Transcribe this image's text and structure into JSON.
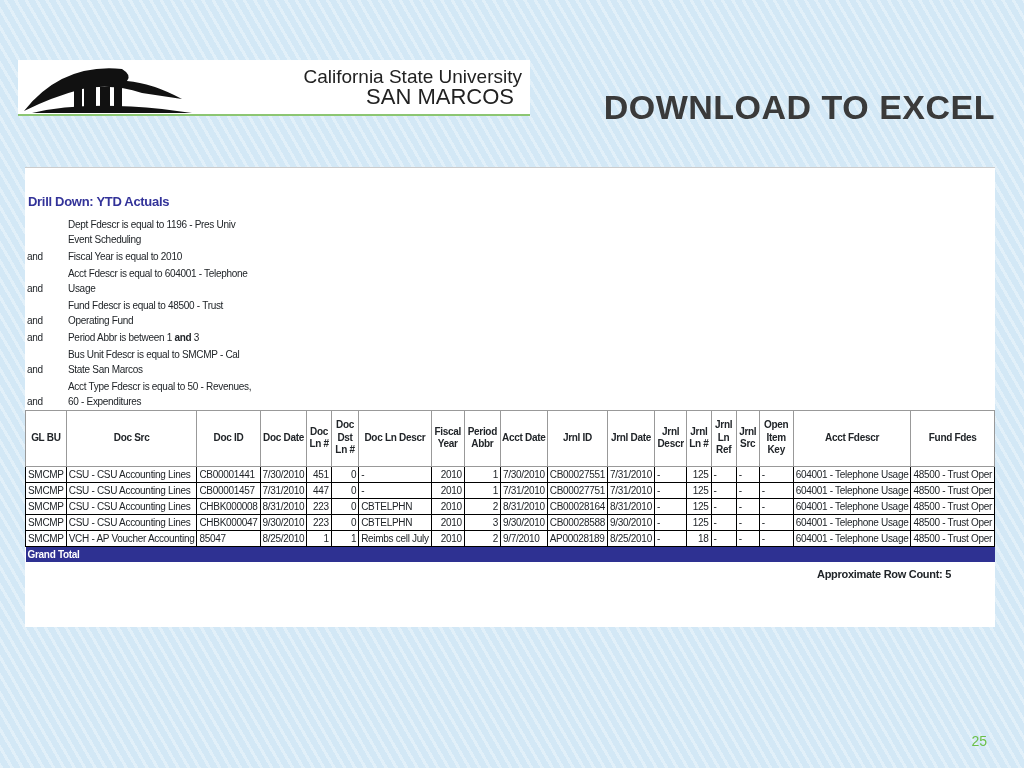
{
  "logo": {
    "line1": "California State University",
    "line2": "SAN MARCOS"
  },
  "title": "DOWNLOAD TO EXCEL",
  "report": {
    "title": "Drill Down: YTD Actuals",
    "filters": [
      {
        "text": "Dept Fdescr is equal to 1196 - Pres Univ Event Scheduling"
      },
      {
        "conjunction": "and",
        "text": "Fiscal Year is equal to 2010"
      },
      {
        "conjunction": "and",
        "text": "Acct Fdescr is equal to 604001 - Telephone Usage"
      },
      {
        "conjunction": "and",
        "text": "Fund Fdescr is equal to 48500 - Trust Operating Fund"
      },
      {
        "conjunction": "and",
        "text": "Period Abbr is between 1 **and** 3"
      },
      {
        "conjunction": "and",
        "text": "Bus Unit Fdescr is equal to SMCMP - Cal State San Marcos"
      },
      {
        "conjunction": "and",
        "text": "Acct Type Fdescr is equal to 50 - Revenues, 60 - Expenditures"
      }
    ],
    "columns": [
      {
        "label": "GL BU",
        "kind": "text"
      },
      {
        "label": "Doc Src",
        "kind": "text"
      },
      {
        "label": "Doc ID",
        "kind": "text"
      },
      {
        "label": "Doc Date",
        "kind": "text"
      },
      {
        "label": "Doc Ln #",
        "kind": "number"
      },
      {
        "label": "Doc Dst Ln #",
        "kind": "number"
      },
      {
        "label": "Doc Ln Descr",
        "kind": "text"
      },
      {
        "label": "Fiscal Year",
        "kind": "number"
      },
      {
        "label": "Period Abbr",
        "kind": "number"
      },
      {
        "label": "Acct Date",
        "kind": "text"
      },
      {
        "label": "Jrnl ID",
        "kind": "text"
      },
      {
        "label": "Jrnl Date",
        "kind": "text"
      },
      {
        "label": "Jrnl Descr",
        "kind": "text"
      },
      {
        "label": "Jrnl Ln #",
        "kind": "number"
      },
      {
        "label": "Jrnl Ln Ref",
        "kind": "text"
      },
      {
        "label": "Jrnl Src",
        "kind": "text"
      },
      {
        "label": "Open Item Key",
        "kind": "text"
      },
      {
        "label": "Acct Fdescr",
        "kind": "text"
      },
      {
        "label": "Fund Fdes",
        "kind": "text"
      }
    ],
    "rows": [
      [
        "SMCMP",
        "CSU - CSU Accounting Lines",
        "CB00001441",
        "7/30/2010",
        "451",
        "0",
        "-",
        "2010",
        "1",
        "7/30/2010",
        "CB00027551",
        "7/31/2010",
        "-",
        "125",
        "-",
        "-",
        "-",
        "604001 - Telephone Usage",
        "48500 - Trust Oper"
      ],
      [
        "SMCMP",
        "CSU - CSU Accounting Lines",
        "CB00001457",
        "7/31/2010",
        "447",
        "0",
        "-",
        "2010",
        "1",
        "7/31/2010",
        "CB00027751",
        "7/31/2010",
        "-",
        "125",
        "-",
        "-",
        "-",
        "604001 - Telephone Usage",
        "48500 - Trust Oper"
      ],
      [
        "SMCMP",
        "CSU - CSU Accounting Lines",
        "CHBK000008",
        "8/31/2010",
        "223",
        "0",
        "CBTELPHN",
        "2010",
        "2",
        "8/31/2010",
        "CB00028164",
        "8/31/2010",
        "-",
        "125",
        "-",
        "-",
        "-",
        "604001 - Telephone Usage",
        "48500 - Trust Oper"
      ],
      [
        "SMCMP",
        "CSU - CSU Accounting Lines",
        "CHBK000047",
        "9/30/2010",
        "223",
        "0",
        "CBTELPHN",
        "2010",
        "3",
        "9/30/2010",
        "CB00028588",
        "9/30/2010",
        "-",
        "125",
        "-",
        "-",
        "-",
        "604001 - Telephone Usage",
        "48500 - Trust Oper"
      ],
      [
        "SMCMP",
        "VCH - AP Voucher Accounting",
        "85047",
        "8/25/2010",
        "1",
        "1",
        "Reimbs cell July",
        "2010",
        "2",
        "9/7/2010",
        "AP00028189",
        "8/25/2010",
        "-",
        "18",
        "-",
        "-",
        "-",
        "604001 - Telephone Usage",
        "48500 - Trust Oper"
      ]
    ],
    "grand_total": "Grand Total",
    "row_count": "Approximate Row Count: 5"
  },
  "page_number": "25"
}
